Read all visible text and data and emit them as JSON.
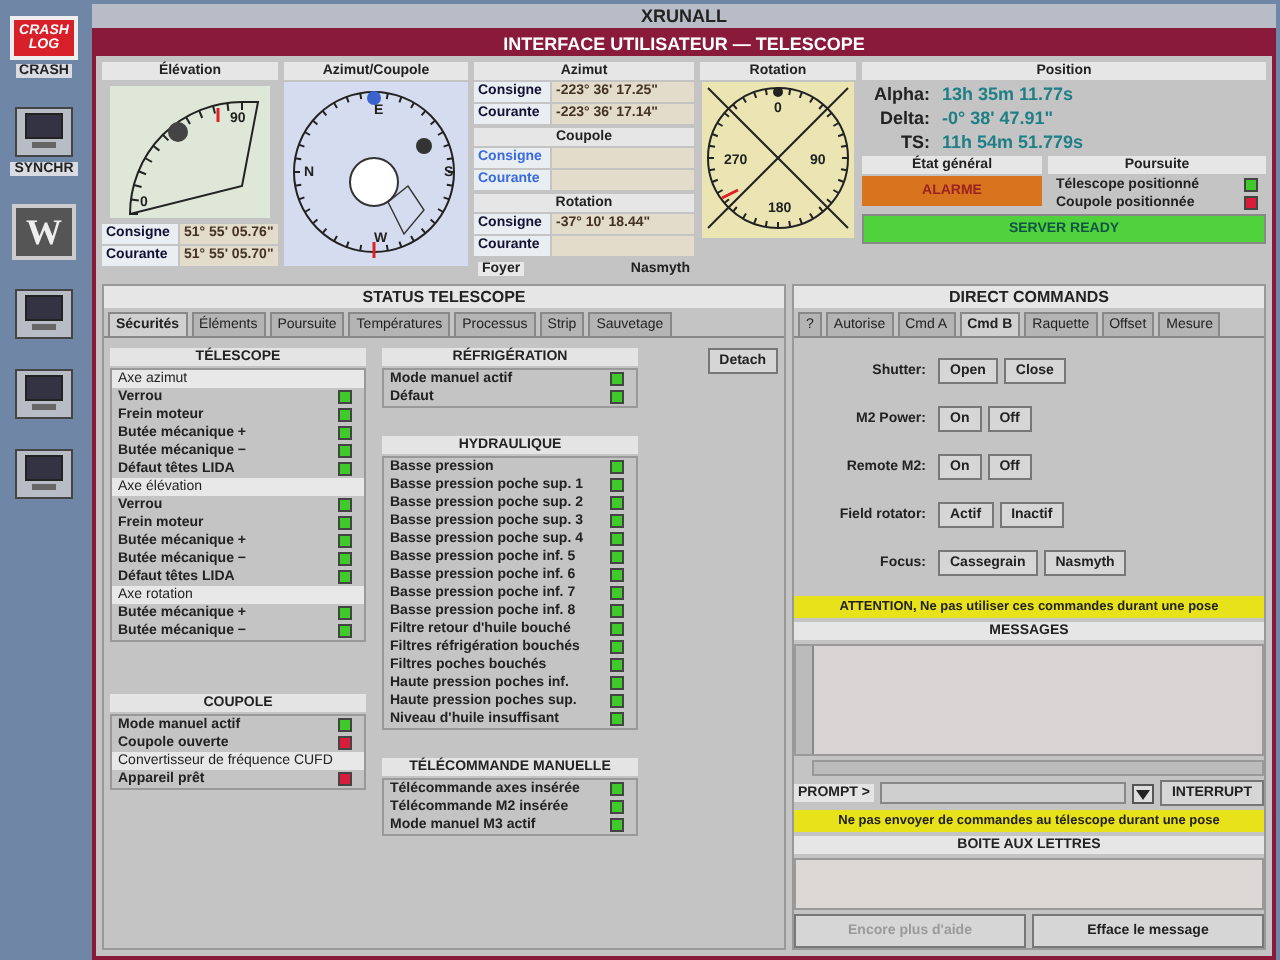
{
  "desktop": {
    "icons": [
      {
        "kind": "crash",
        "lines": [
          "CRASH",
          "LOG"
        ],
        "label": "CRASH"
      },
      {
        "kind": "computer",
        "label": "SYNCHR"
      },
      {
        "kind": "letter",
        "glyph": "W"
      },
      {
        "kind": "computer"
      },
      {
        "kind": "computer"
      },
      {
        "kind": "computer"
      }
    ]
  },
  "outer_window": {
    "title": "XRUNALL"
  },
  "window": {
    "title": "INTERFACE UTILISATEUR — TELESCOPE"
  },
  "elevation": {
    "title": "Élévation",
    "scale_labels": [
      "0",
      "90"
    ],
    "rows": [
      {
        "label": "Consigne",
        "value": "51° 55' 05.76\""
      },
      {
        "label": "Courante",
        "value": "51° 55' 05.70\""
      }
    ]
  },
  "azimut_coupole": {
    "title": "Azimut/Coupole",
    "cardinals": [
      "N",
      "E",
      "S",
      "W"
    ]
  },
  "readouts": [
    {
      "title": "Azimut",
      "rows": [
        {
          "label": "Consigne",
          "value": "-223° 36' 17.25\"",
          "inactive": false
        },
        {
          "label": "Courante",
          "value": "-223° 36' 17.14\"",
          "inactive": false
        }
      ]
    },
    {
      "title": "Coupole",
      "rows": [
        {
          "label": "Consigne",
          "inactive": true
        },
        {
          "label": "Courante",
          "inactive": true
        }
      ]
    },
    {
      "title": "Rotation",
      "rows": [
        {
          "label": "Consigne",
          "value": "-37° 10' 18.44\"",
          "inactive": false
        },
        {
          "label": "Courante",
          "inactive": false
        }
      ]
    }
  ],
  "focus": {
    "label": "Foyer",
    "value": "Nasmyth"
  },
  "rotation": {
    "title": "Rotation",
    "scale_labels": [
      "0",
      "90",
      "180",
      "270"
    ]
  },
  "position": {
    "title": "Position",
    "rows": [
      {
        "label": "Alpha:",
        "value": "13h 35m 11.77s"
      },
      {
        "label": "Delta:",
        "value": "-0° 38' 47.91\""
      },
      {
        "label": "TS:",
        "value": "11h 54m 51.779s"
      }
    ]
  },
  "etat_general": {
    "title": "État général",
    "status": "ALARME",
    "kind": "alarm"
  },
  "poursuite": {
    "title": "Poursuite",
    "items": [
      {
        "label": "Télescope positionné",
        "alarm": false
      },
      {
        "label": "Coupole positionnée",
        "alarm": true
      }
    ]
  },
  "server": {
    "status": "SERVER READY",
    "kind": "ready"
  },
  "status_telescope": {
    "title": "STATUS TELESCOPE",
    "detach": "Detach",
    "tabs": [
      {
        "label": "Sécurités",
        "selected": true
      },
      {
        "label": "Éléments",
        "selected": false
      },
      {
        "label": "Poursuite",
        "selected": false
      },
      {
        "label": "Températures",
        "selected": false
      },
      {
        "label": "Processus",
        "selected": false
      },
      {
        "label": "Strip",
        "selected": false
      },
      {
        "label": "Sauvetage",
        "selected": false
      }
    ],
    "columns": [
      [
        {
          "title": "TÉLESCOPE",
          "items": [
            {
              "kind": "section",
              "label": "Axe azimut"
            },
            {
              "kind": "flag",
              "label": "Verrou",
              "alarm": false
            },
            {
              "kind": "flag",
              "label": "Frein moteur",
              "alarm": false
            },
            {
              "kind": "flag",
              "label": "Butée mécanique +",
              "alarm": false
            },
            {
              "kind": "flag",
              "label": "Butée mécanique −",
              "alarm": false
            },
            {
              "kind": "flag",
              "label": "Défaut têtes LIDA",
              "alarm": false
            },
            {
              "kind": "section",
              "label": "Axe élévation"
            },
            {
              "kind": "flag",
              "label": "Verrou",
              "alarm": false
            },
            {
              "kind": "flag",
              "label": "Frein moteur",
              "alarm": false
            },
            {
              "kind": "flag",
              "label": "Butée mécanique +",
              "alarm": false
            },
            {
              "kind": "flag",
              "label": "Butée mécanique −",
              "alarm": false
            },
            {
              "kind": "flag",
              "label": "Défaut têtes LIDA",
              "alarm": false
            },
            {
              "kind": "section",
              "label": "Axe rotation"
            },
            {
              "kind": "flag",
              "label": "Butée mécanique +",
              "alarm": false
            },
            {
              "kind": "flag",
              "label": "Butée mécanique −",
              "alarm": false
            }
          ]
        },
        {
          "title": "COUPOLE",
          "items": [
            {
              "kind": "flag",
              "label": "Mode manuel actif",
              "alarm": false
            },
            {
              "kind": "flag",
              "label": "Coupole ouverte",
              "alarm": true
            },
            {
              "kind": "section",
              "label": "Convertisseur de fréquence CUFD"
            },
            {
              "kind": "flag",
              "label": "Appareil prêt",
              "alarm": true
            }
          ]
        }
      ],
      [
        {
          "title": "RÉFRIGÉRATION",
          "items": [
            {
              "kind": "flag",
              "label": "Mode manuel actif",
              "alarm": false
            },
            {
              "kind": "flag",
              "label": "Défaut",
              "alarm": false
            }
          ]
        },
        {
          "title": "HYDRAULIQUE",
          "items": [
            {
              "kind": "flag",
              "label": "Basse pression",
              "alarm": false
            },
            {
              "kind": "flag",
              "label": "Basse pression poche sup. 1",
              "alarm": false
            },
            {
              "kind": "flag",
              "label": "Basse pression poche sup. 2",
              "alarm": false
            },
            {
              "kind": "flag",
              "label": "Basse pression poche sup. 3",
              "alarm": false
            },
            {
              "kind": "flag",
              "label": "Basse pression poche sup. 4",
              "alarm": false
            },
            {
              "kind": "flag",
              "label": "Basse pression poche inf. 5",
              "alarm": false
            },
            {
              "kind": "flag",
              "label": "Basse pression poche inf. 6",
              "alarm": false
            },
            {
              "kind": "flag",
              "label": "Basse pression poche inf. 7",
              "alarm": false
            },
            {
              "kind": "flag",
              "label": "Basse pression poche inf. 8",
              "alarm": false
            },
            {
              "kind": "flag",
              "label": "Filtre retour d'huile bouché",
              "alarm": false
            },
            {
              "kind": "flag",
              "label": "Filtres réfrigération bouchés",
              "alarm": false
            },
            {
              "kind": "flag",
              "label": "Filtres poches bouchés",
              "alarm": false
            },
            {
              "kind": "flag",
              "label": "Haute pression poches inf.",
              "alarm": false
            },
            {
              "kind": "flag",
              "label": "Haute pression poches sup.",
              "alarm": false
            },
            {
              "kind": "flag",
              "label": "Niveau d'huile insuffisant",
              "alarm": false
            }
          ]
        },
        {
          "title": "TÉLÉCOMMANDE MANUELLE",
          "items": [
            {
              "kind": "flag",
              "label": "Télécommande axes insérée",
              "alarm": false
            },
            {
              "kind": "flag",
              "label": "Télécommande M2 insérée",
              "alarm": false
            },
            {
              "kind": "flag",
              "label": "Mode manuel M3 actif",
              "alarm": false
            }
          ]
        }
      ]
    ]
  },
  "direct_commands": {
    "title": "DIRECT COMMANDS",
    "tabs": [
      {
        "label": "?",
        "selected": false
      },
      {
        "label": "Autorise",
        "selected": false
      },
      {
        "label": "Cmd A",
        "selected": false
      },
      {
        "label": "Cmd B",
        "selected": true
      },
      {
        "label": "Raquette",
        "selected": false
      },
      {
        "label": "Offset",
        "selected": false
      },
      {
        "label": "Mesure",
        "selected": false
      }
    ],
    "commands": [
      {
        "label": "Shutter:",
        "buttons": [
          "Open",
          "Close"
        ]
      },
      {
        "label": "M2 Power:",
        "buttons": [
          "On",
          "Off"
        ]
      },
      {
        "label": "Remote M2:",
        "buttons": [
          "On",
          "Off"
        ]
      },
      {
        "label": "Field rotator:",
        "buttons": [
          "Actif",
          "Inactif"
        ]
      },
      {
        "label": "Focus:",
        "buttons": [
          "Cassegrain",
          "Nasmyth"
        ]
      }
    ],
    "warning": "ATTENTION, Ne pas utiliser ces commandes durant une pose",
    "messages_title": "MESSAGES",
    "prompt_label": "PROMPT >",
    "interrupt": "INTERRUPT",
    "prompt_warning": "Ne pas envoyer de commandes au télescope durant une pose",
    "mailbox_title": "BOITE AUX LETTRES",
    "buttons": [
      {
        "label": "Encore plus d'aide",
        "disabled": true
      },
      {
        "label": "Efface le message",
        "disabled": false
      }
    ]
  }
}
